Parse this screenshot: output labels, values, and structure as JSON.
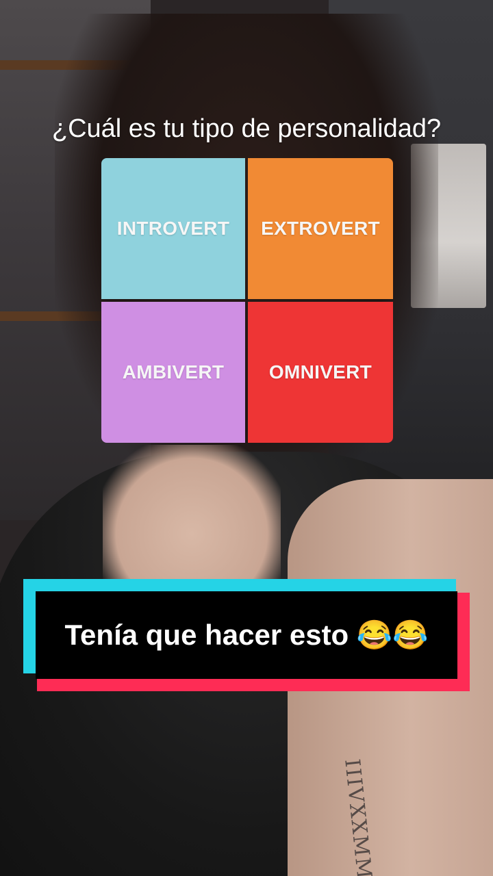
{
  "question": "¿Cuál es tu tipo de personalidad?",
  "options": [
    {
      "label": "INTROVERT",
      "color": "#8fd2dd"
    },
    {
      "label": "EXTROVERT",
      "color": "#f18a34"
    },
    {
      "label": "AMBIVERT",
      "color": "#cf8fe3"
    },
    {
      "label": "OMNIVERT",
      "color": "#ee3535"
    }
  ],
  "caption": "Tenía que hacer esto 😂😂",
  "tattoo": "IIIVXXMM",
  "caption_colors": {
    "accent_cyan": "#25d3e6",
    "accent_red": "#fe2c55",
    "box": "#000000"
  }
}
